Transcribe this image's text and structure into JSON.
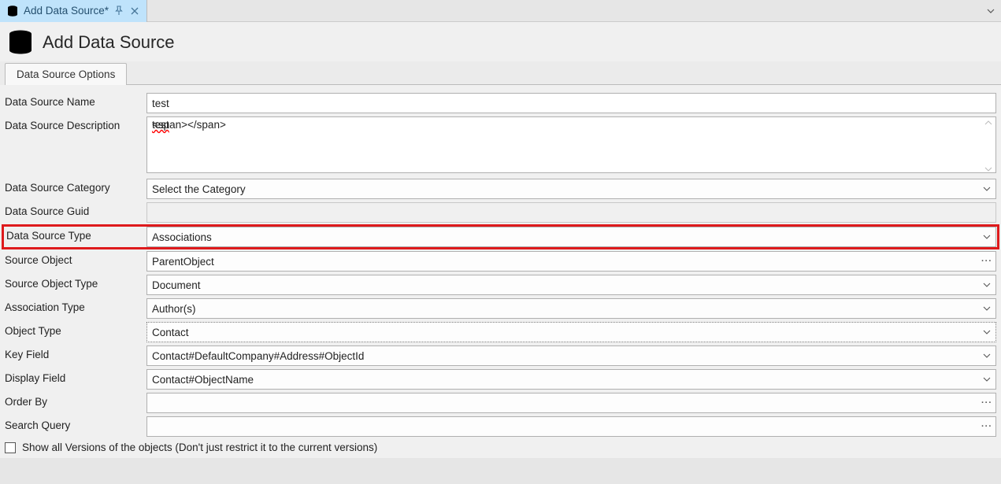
{
  "tab": {
    "title": "Add Data Source*"
  },
  "header": {
    "title": "Add Data Source"
  },
  "inner_tab": {
    "label": "Data Source Options"
  },
  "labels": {
    "name": "Data Source Name",
    "description": "Data Source Description",
    "category": "Data Source Category",
    "guid": "Data Source Guid",
    "type": "Data Source Type",
    "source_object": "Source Object",
    "source_object_type": "Source Object Type",
    "association_type": "Association Type",
    "object_type": "Object Type",
    "key_field": "Key Field",
    "display_field": "Display Field",
    "order_by": "Order By",
    "search_query": "Search Query"
  },
  "values": {
    "name": "test",
    "description": "test",
    "category": "Select the Category",
    "guid": "",
    "type": "Associations",
    "source_object": "ParentObject",
    "source_object_type": "Document",
    "association_type": "Author(s)",
    "object_type": "Contact",
    "key_field": "Contact#DefaultCompany#Address#ObjectId",
    "display_field": "Contact#ObjectName",
    "order_by": "",
    "search_query": ""
  },
  "checkbox": {
    "show_all_versions": "Show all Versions of the objects (Don't just restrict it to the current versions)",
    "checked": false
  }
}
